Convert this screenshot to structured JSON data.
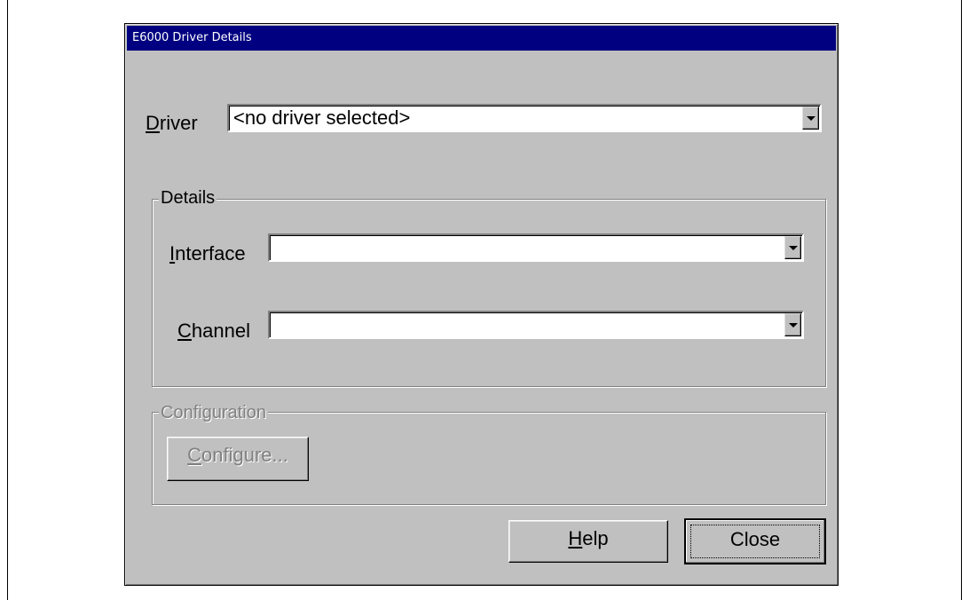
{
  "dialog": {
    "title": "E6000 Driver Details",
    "driver": {
      "label": "Driver",
      "accel": "D",
      "rest": "river",
      "value": "<no driver selected>"
    },
    "details": {
      "title": "Details",
      "interface": {
        "label": "Interface",
        "accel": "I",
        "rest": "nterface",
        "value": ""
      },
      "channel": {
        "label": "Channel",
        "accel": "C",
        "rest": "hannel",
        "value": ""
      }
    },
    "configuration": {
      "title": "Configuration",
      "configure_button": {
        "label": "Configure...",
        "accel": "C",
        "rest": "onfigure...",
        "enabled": false
      }
    },
    "buttons": {
      "help": {
        "label": "Help",
        "accel": "H",
        "rest": "elp"
      },
      "close": {
        "label": "Close"
      }
    }
  }
}
